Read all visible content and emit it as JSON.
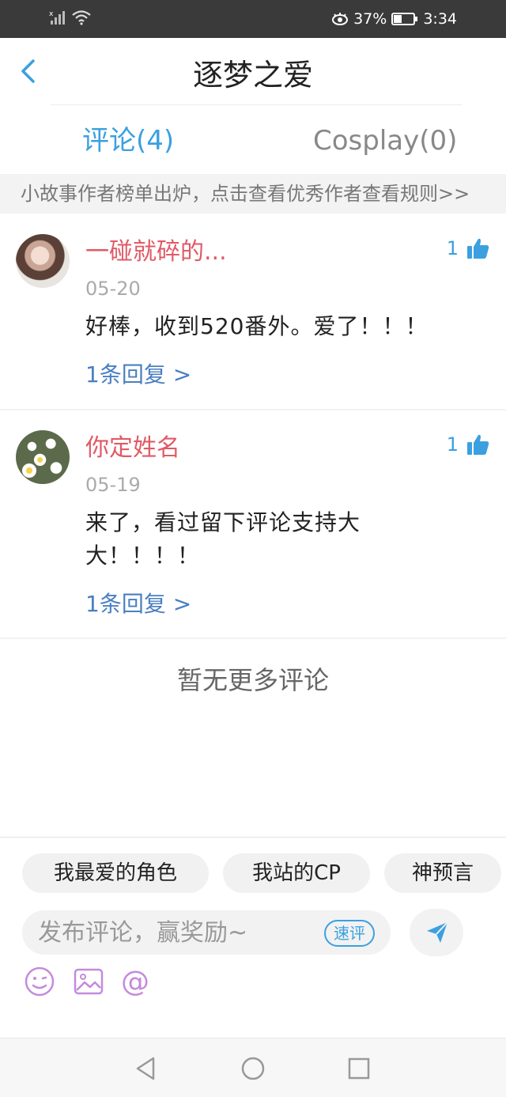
{
  "status_bar": {
    "battery": "37%",
    "time": "3:34"
  },
  "header": {
    "title": "逐梦之爱"
  },
  "tabs": [
    {
      "label": "评论(4)"
    },
    {
      "label": "Cosplay(0)"
    }
  ],
  "notice": {
    "text": "小故事作者榜单出炉，点击查看优秀作者",
    "link": "查看规则>>"
  },
  "comments": [
    {
      "name": "一碰就碎的...",
      "date": "05-20",
      "text": "好棒，收到520番外。爱了！！！",
      "likes": "1",
      "replies": "1条回复 >"
    },
    {
      "name": "你定姓名",
      "date": "05-19",
      "text": "来了，看过留下评论支持大大！！！！",
      "likes": "1",
      "replies": "1条回复 >"
    }
  ],
  "no_more": "暂无更多评论",
  "quick_tags": [
    "我最爱的角色",
    "我站的CP",
    "神预言"
  ],
  "input": {
    "placeholder": "发布评论，赢奖励~",
    "quick_label": "速评"
  },
  "colors": {
    "accent": "#3ba0e0",
    "name": "#e05a66",
    "reply_link": "#4a7fc1",
    "icon_purple": "#c48bdc"
  }
}
